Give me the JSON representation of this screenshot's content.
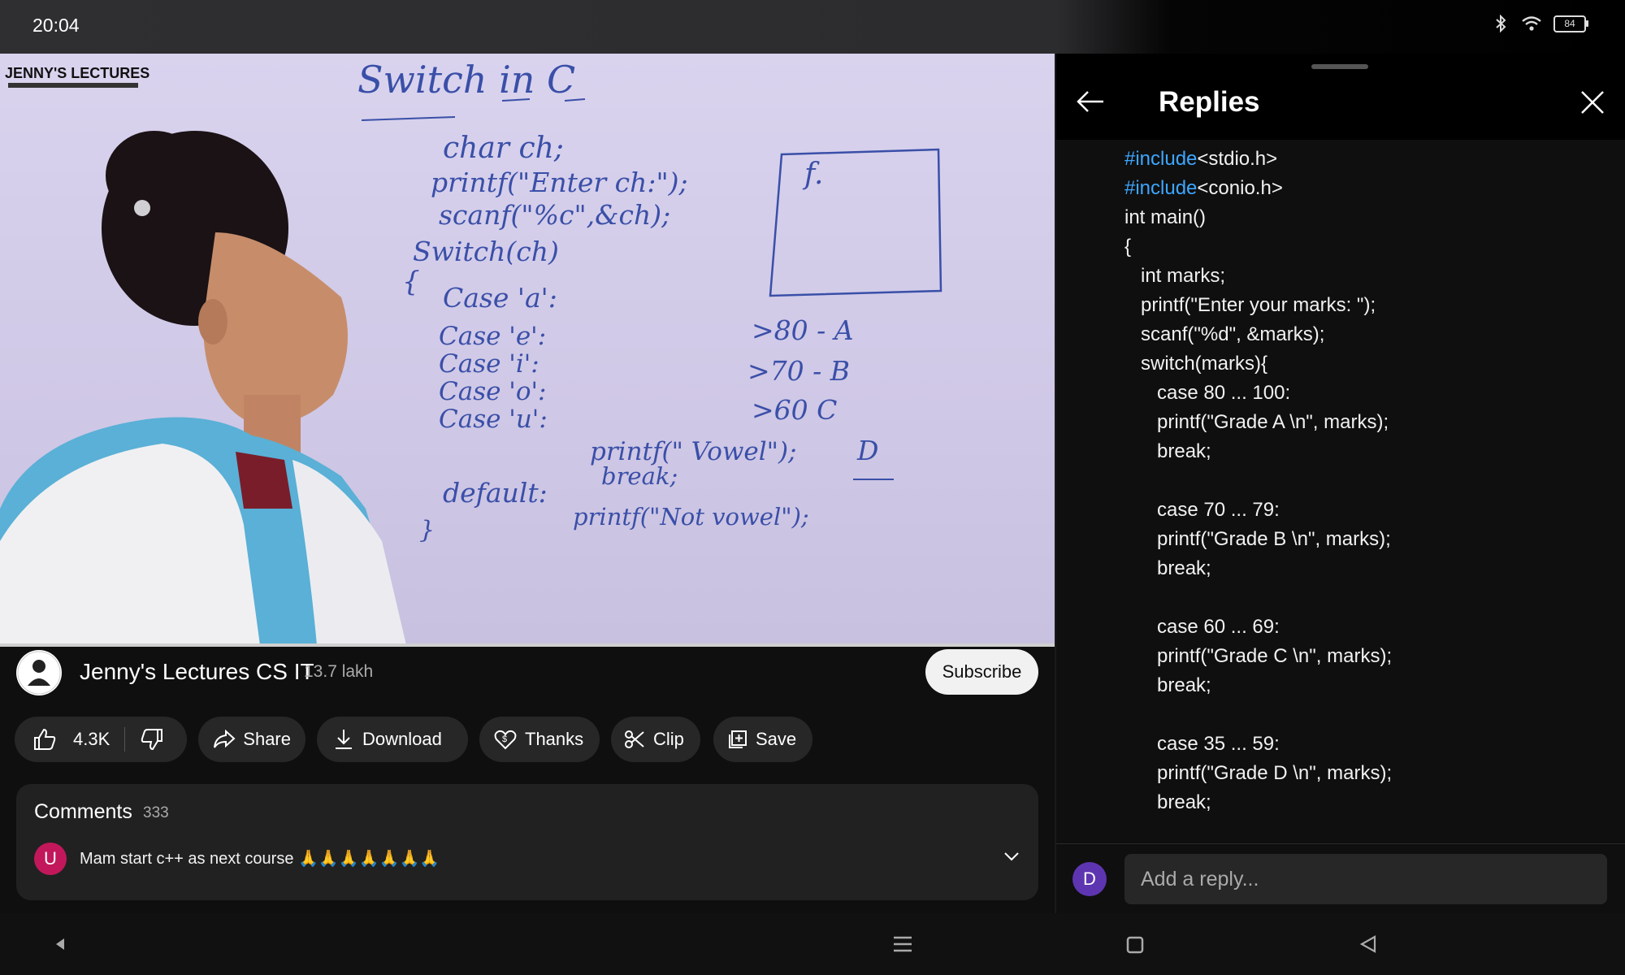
{
  "status_bar": {
    "time": "20:04",
    "battery": "84",
    "icons": [
      "bluetooth-icon",
      "wifi-icon",
      "battery-icon"
    ]
  },
  "video": {
    "watermark": "JENNY'S LECTURES",
    "board_title": "Switch in C",
    "board_lines": [
      "char ch;",
      "printf(\"Enter ch:\");",
      "scanf(\"%c\",&ch);",
      "Switch(ch)",
      "{",
      "Case 'a':",
      "Case 'e':",
      "Case 'i':",
      "Case 'o':",
      "Case 'u':",
      "printf(\" Vowel\");",
      "break;",
      "default:",
      "printf(\"Not vowel\");",
      "}"
    ],
    "board_box_label": "f.",
    "board_grades": [
      ">80 - A",
      ">70 - B",
      ">60  C",
      "D"
    ]
  },
  "channel": {
    "name": "Jenny's Lectures CS IT",
    "subscribers": "13.7 lakh",
    "subscribe_label": "Subscribe"
  },
  "actions": {
    "likes": "4.3K",
    "share": "Share",
    "download": "Download",
    "thanks": "Thanks",
    "clip": "Clip",
    "save": "Save"
  },
  "comments": {
    "title": "Comments",
    "count": "333",
    "first": {
      "avatar_letter": "U",
      "text": "Mam start c++ as next course 🙏🙏🙏🙏🙏🙏🙏"
    }
  },
  "replies": {
    "title": "Replies",
    "code_lines": [
      {
        "tag": "#include",
        "rest": "<stdio.h>"
      },
      {
        "tag": "#include",
        "rest": "<conio.h>"
      },
      {
        "tag": "",
        "rest": "int main()"
      },
      {
        "tag": "",
        "rest": "{"
      },
      {
        "tag": "",
        "rest": "   int marks;"
      },
      {
        "tag": "",
        "rest": "   printf(\"Enter your marks: \");"
      },
      {
        "tag": "",
        "rest": "   scanf(\"%d\", &marks);"
      },
      {
        "tag": "",
        "rest": "   switch(marks){"
      },
      {
        "tag": "",
        "rest": "      case 80 ... 100:"
      },
      {
        "tag": "",
        "rest": "      printf(\"Grade A \\n\", marks);"
      },
      {
        "tag": "",
        "rest": "      break;"
      },
      {
        "tag": "",
        "rest": ""
      },
      {
        "tag": "",
        "rest": "      case 70 ... 79:"
      },
      {
        "tag": "",
        "rest": "      printf(\"Grade B \\n\", marks);"
      },
      {
        "tag": "",
        "rest": "      break;"
      },
      {
        "tag": "",
        "rest": ""
      },
      {
        "tag": "",
        "rest": "      case 60 ... 69:"
      },
      {
        "tag": "",
        "rest": "      printf(\"Grade C \\n\", marks);"
      },
      {
        "tag": "",
        "rest": "      break;"
      },
      {
        "tag": "",
        "rest": ""
      },
      {
        "tag": "",
        "rest": "      case 35 ... 59:"
      },
      {
        "tag": "",
        "rest": "      printf(\"Grade D \\n\", marks);"
      },
      {
        "tag": "",
        "rest": "      break;"
      }
    ],
    "user_avatar_letter": "D",
    "reply_placeholder": "Add a reply..."
  },
  "colors": {
    "background": "#0f0f0f",
    "pill": "#272727",
    "link": "#3ea6ff",
    "whiteboard": "#d6d0ec",
    "ink": "#3a4fa8"
  }
}
